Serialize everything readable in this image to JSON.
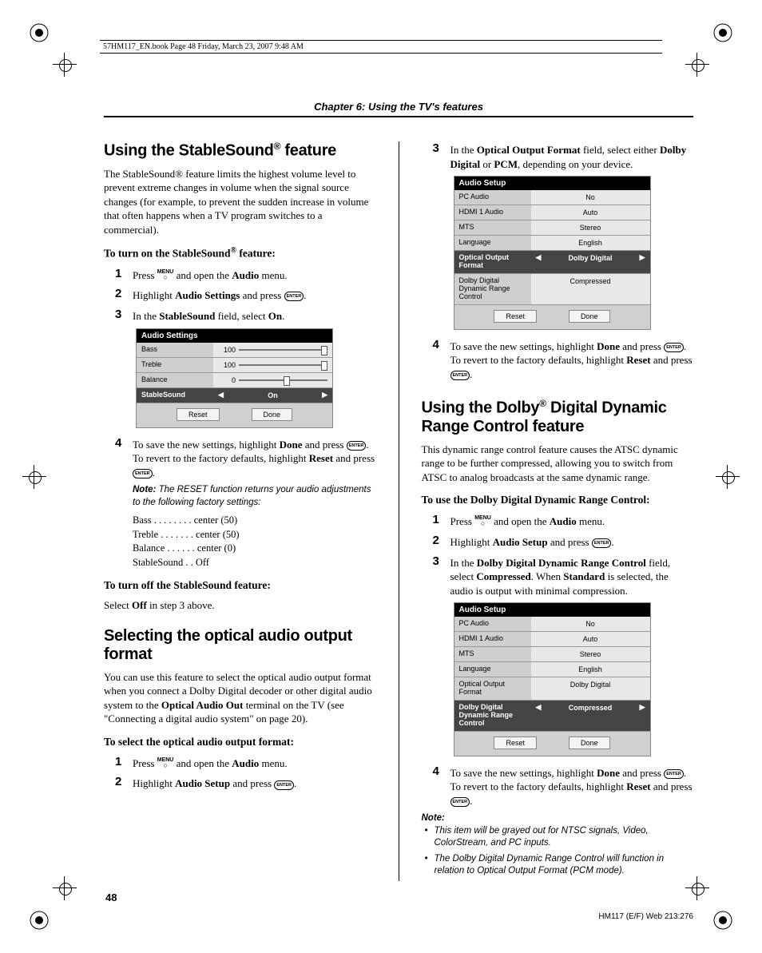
{
  "meta_line": "57HM117_EN.book  Page 48  Friday, March 23, 2007  9:48 AM",
  "chapter": "Chapter 6: Using the TV's features",
  "page_number": "48",
  "rev_code": "HM117 (E/F) Web 213:276",
  "left": {
    "h1_a": "Using the StableSound",
    "h1_sup": "®",
    "h1_b": " feature",
    "intro": "The StableSound® feature limits the highest volume level to prevent extreme changes in volume when the signal source changes (for example, to prevent the sudden increase in volume that often happens when a TV program switches to a commercial).",
    "sub1_a": "To turn on the StableSound",
    "sub1_sup": "®",
    "sub1_b": " feature:",
    "s1_a": "Press ",
    "s1_b": " and open the ",
    "s1_bold": "Audio",
    "s1_c": " menu.",
    "s2_a": "Highlight ",
    "s2_bold": "Audio Settings",
    "s2_b": " and press ",
    "s3_a": "In the ",
    "s3_bold": "StableSound",
    "s3_b": " field, select ",
    "s3_bold2": "On",
    "s3_c": ".",
    "menu1": {
      "title": "Audio Settings",
      "bass_label": "Bass",
      "bass_val": "100",
      "treble_label": "Treble",
      "treble_val": "100",
      "balance_label": "Balance",
      "balance_val": "0",
      "ss_label": "StableSound",
      "ss_val": "On",
      "reset": "Reset",
      "done": "Done"
    },
    "s4_a": "To save the new settings, highlight ",
    "s4_bold1": "Done",
    "s4_b": " and press ",
    "s4_c": ". To revert to the factory defaults, highlight ",
    "s4_bold2": "Reset",
    "s4_d": " and press ",
    "note1_lbl": "Note:",
    "note1": " The RESET function returns your audio adjustments to the following factory settings:",
    "factory": {
      "bass": "Bass  . . . . . . . .  center (50)",
      "treble": "Treble  . . . . . . .  center (50)",
      "balance": "Balance . . . . . .  center (0)",
      "ss": "StableSound  . .  Off"
    },
    "sub2": "To turn off the StableSound feature:",
    "sub2_body_a": "Select ",
    "sub2_body_bold": "Off",
    "sub2_body_b": " in step 3 above.",
    "h2": "Selecting the optical audio output format",
    "h2_intro_a": "You can use this feature to select the optical audio output format when you connect a Dolby Digital decoder or other digital audio system to the ",
    "h2_intro_bold": "Optical Audio Out",
    "h2_intro_b": " terminal on the TV (see \"Connecting a digital audio system\" on page 20).",
    "sub3": "To select the optical audio output format:",
    "h2_s1_a": "Press ",
    "h2_s1_b": " and open the ",
    "h2_s1_bold": "Audio",
    "h2_s1_c": " menu.",
    "h2_s2_a": "Highlight ",
    "h2_s2_bold": "Audio Setup",
    "h2_s2_b": " and press "
  },
  "right": {
    "s3_a": "In the ",
    "s3_bold": "Optical Output Format",
    "s3_b": " field, select either ",
    "s3_bold2": "Dolby Digital",
    "s3_or": " or ",
    "s3_bold3": "PCM",
    "s3_c": ", depending on your device.",
    "menu2": {
      "title": "Audio Setup",
      "pc_label": "PC Audio",
      "pc_val": "No",
      "hdmi_label": "HDMI 1 Audio",
      "hdmi_val": "Auto",
      "mts_label": "MTS",
      "mts_val": "Stereo",
      "lang_label": "Language",
      "lang_val": "English",
      "oof_label": "Optical Output Format",
      "oof_val": "Dolby Digital",
      "drc_label": "Dolby Digital\nDynamic Range Control",
      "drc_val": "Compressed",
      "reset": "Reset",
      "done": "Done"
    },
    "s4_a": "To save the new settings, highlight ",
    "s4_bold1": "Done",
    "s4_b": " and press ",
    "s4_c": ". To revert to the factory defaults, highlight ",
    "s4_bold2": "Reset",
    "s4_d": " and press ",
    "h3_a": "Using the Dolby",
    "h3_sup": "®",
    "h3_b": " Digital Dynamic Range Control feature",
    "h3_intro": "This dynamic range control feature causes the ATSC dynamic range to be further compressed, allowing you to switch from ATSC to analog broadcasts at the same dynamic range.",
    "sub4": "To use the Dolby Digital Dynamic Range Control:",
    "h3_s1_a": "Press ",
    "h3_s1_b": " and open the ",
    "h3_s1_bold": "Audio",
    "h3_s1_c": " menu.",
    "h3_s2_a": "Highlight ",
    "h3_s2_bold": "Audio Setup",
    "h3_s2_b": " and press ",
    "h3_s3_a": "In the ",
    "h3_s3_bold": "Dolby Digital Dynamic Range Control",
    "h3_s3_b": " field, select ",
    "h3_s3_bold2": "Compressed",
    "h3_s3_c": ". When ",
    "h3_s3_bold3": "Standard",
    "h3_s3_d": " is selected, the audio is output with minimal compression.",
    "menu3": {
      "title": "Audio Setup",
      "pc_label": "PC Audio",
      "pc_val": "No",
      "hdmi_label": "HDMI 1 Audio",
      "hdmi_val": "Auto",
      "mts_label": "MTS",
      "mts_val": "Stereo",
      "lang_label": "Language",
      "lang_val": "English",
      "oof_label": "Optical Output Format",
      "oof_val": "Dolby Digital",
      "drc_label": "Dolby Digital\nDynamic Range Control",
      "drc_val": "Compressed",
      "reset": "Reset",
      "done": "Done"
    },
    "h3_s4_a": "To save the new settings, highlight ",
    "h3_s4_bold1": "Done",
    "h3_s4_b": " and press ",
    "h3_s4_c": ". To revert to the factory defaults, highlight ",
    "h3_s4_bold2": "Reset",
    "h3_s4_d": " and press ",
    "note_lbl": "Note:",
    "note_b1": "This item will be grayed out for NTSC signals, Video, ColorStream, and PC inputs.",
    "note_b2": "The Dolby Digital Dynamic Range Control will function in relation to Optical Output Format (PCM mode)."
  },
  "icons": {
    "menu": "MENU",
    "enter": "ENTER"
  }
}
